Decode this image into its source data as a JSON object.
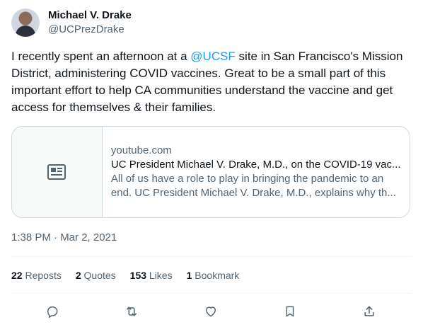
{
  "author": {
    "display_name": "Michael V. Drake",
    "handle": "@UCPrezDrake"
  },
  "tweet": {
    "text_before": "I recently spent an afternoon at a ",
    "mention": "@UCSF",
    "text_after": " site in San Francisco's Mission District, administering COVID vaccines. Great to be a small part of this important effort to help CA communities understand the vaccine and get access for themselves & their families."
  },
  "card": {
    "domain": "youtube.com",
    "title": "UC President Michael V. Drake, M.D., on the COVID-19 vac...",
    "description": "All of us have a role to play in bringing the pandemic to an end. UC President Michael V. Drake, M.D., explains why th...",
    "icon": "article-icon"
  },
  "timestamp": "1:38 PM · Mar 2, 2021",
  "stats": {
    "reposts_count": "22",
    "reposts_label": "Reposts",
    "quotes_count": "2",
    "quotes_label": "Quotes",
    "likes_count": "153",
    "likes_label": "Likes",
    "bookmarks_count": "1",
    "bookmarks_label": "Bookmark"
  },
  "actions": [
    "reply-icon",
    "repost-icon",
    "like-icon",
    "bookmark-icon",
    "share-icon"
  ],
  "colors": {
    "link": "#1d9bf0",
    "muted": "#536471",
    "text": "#0f1419",
    "border": "#cfd9de"
  }
}
